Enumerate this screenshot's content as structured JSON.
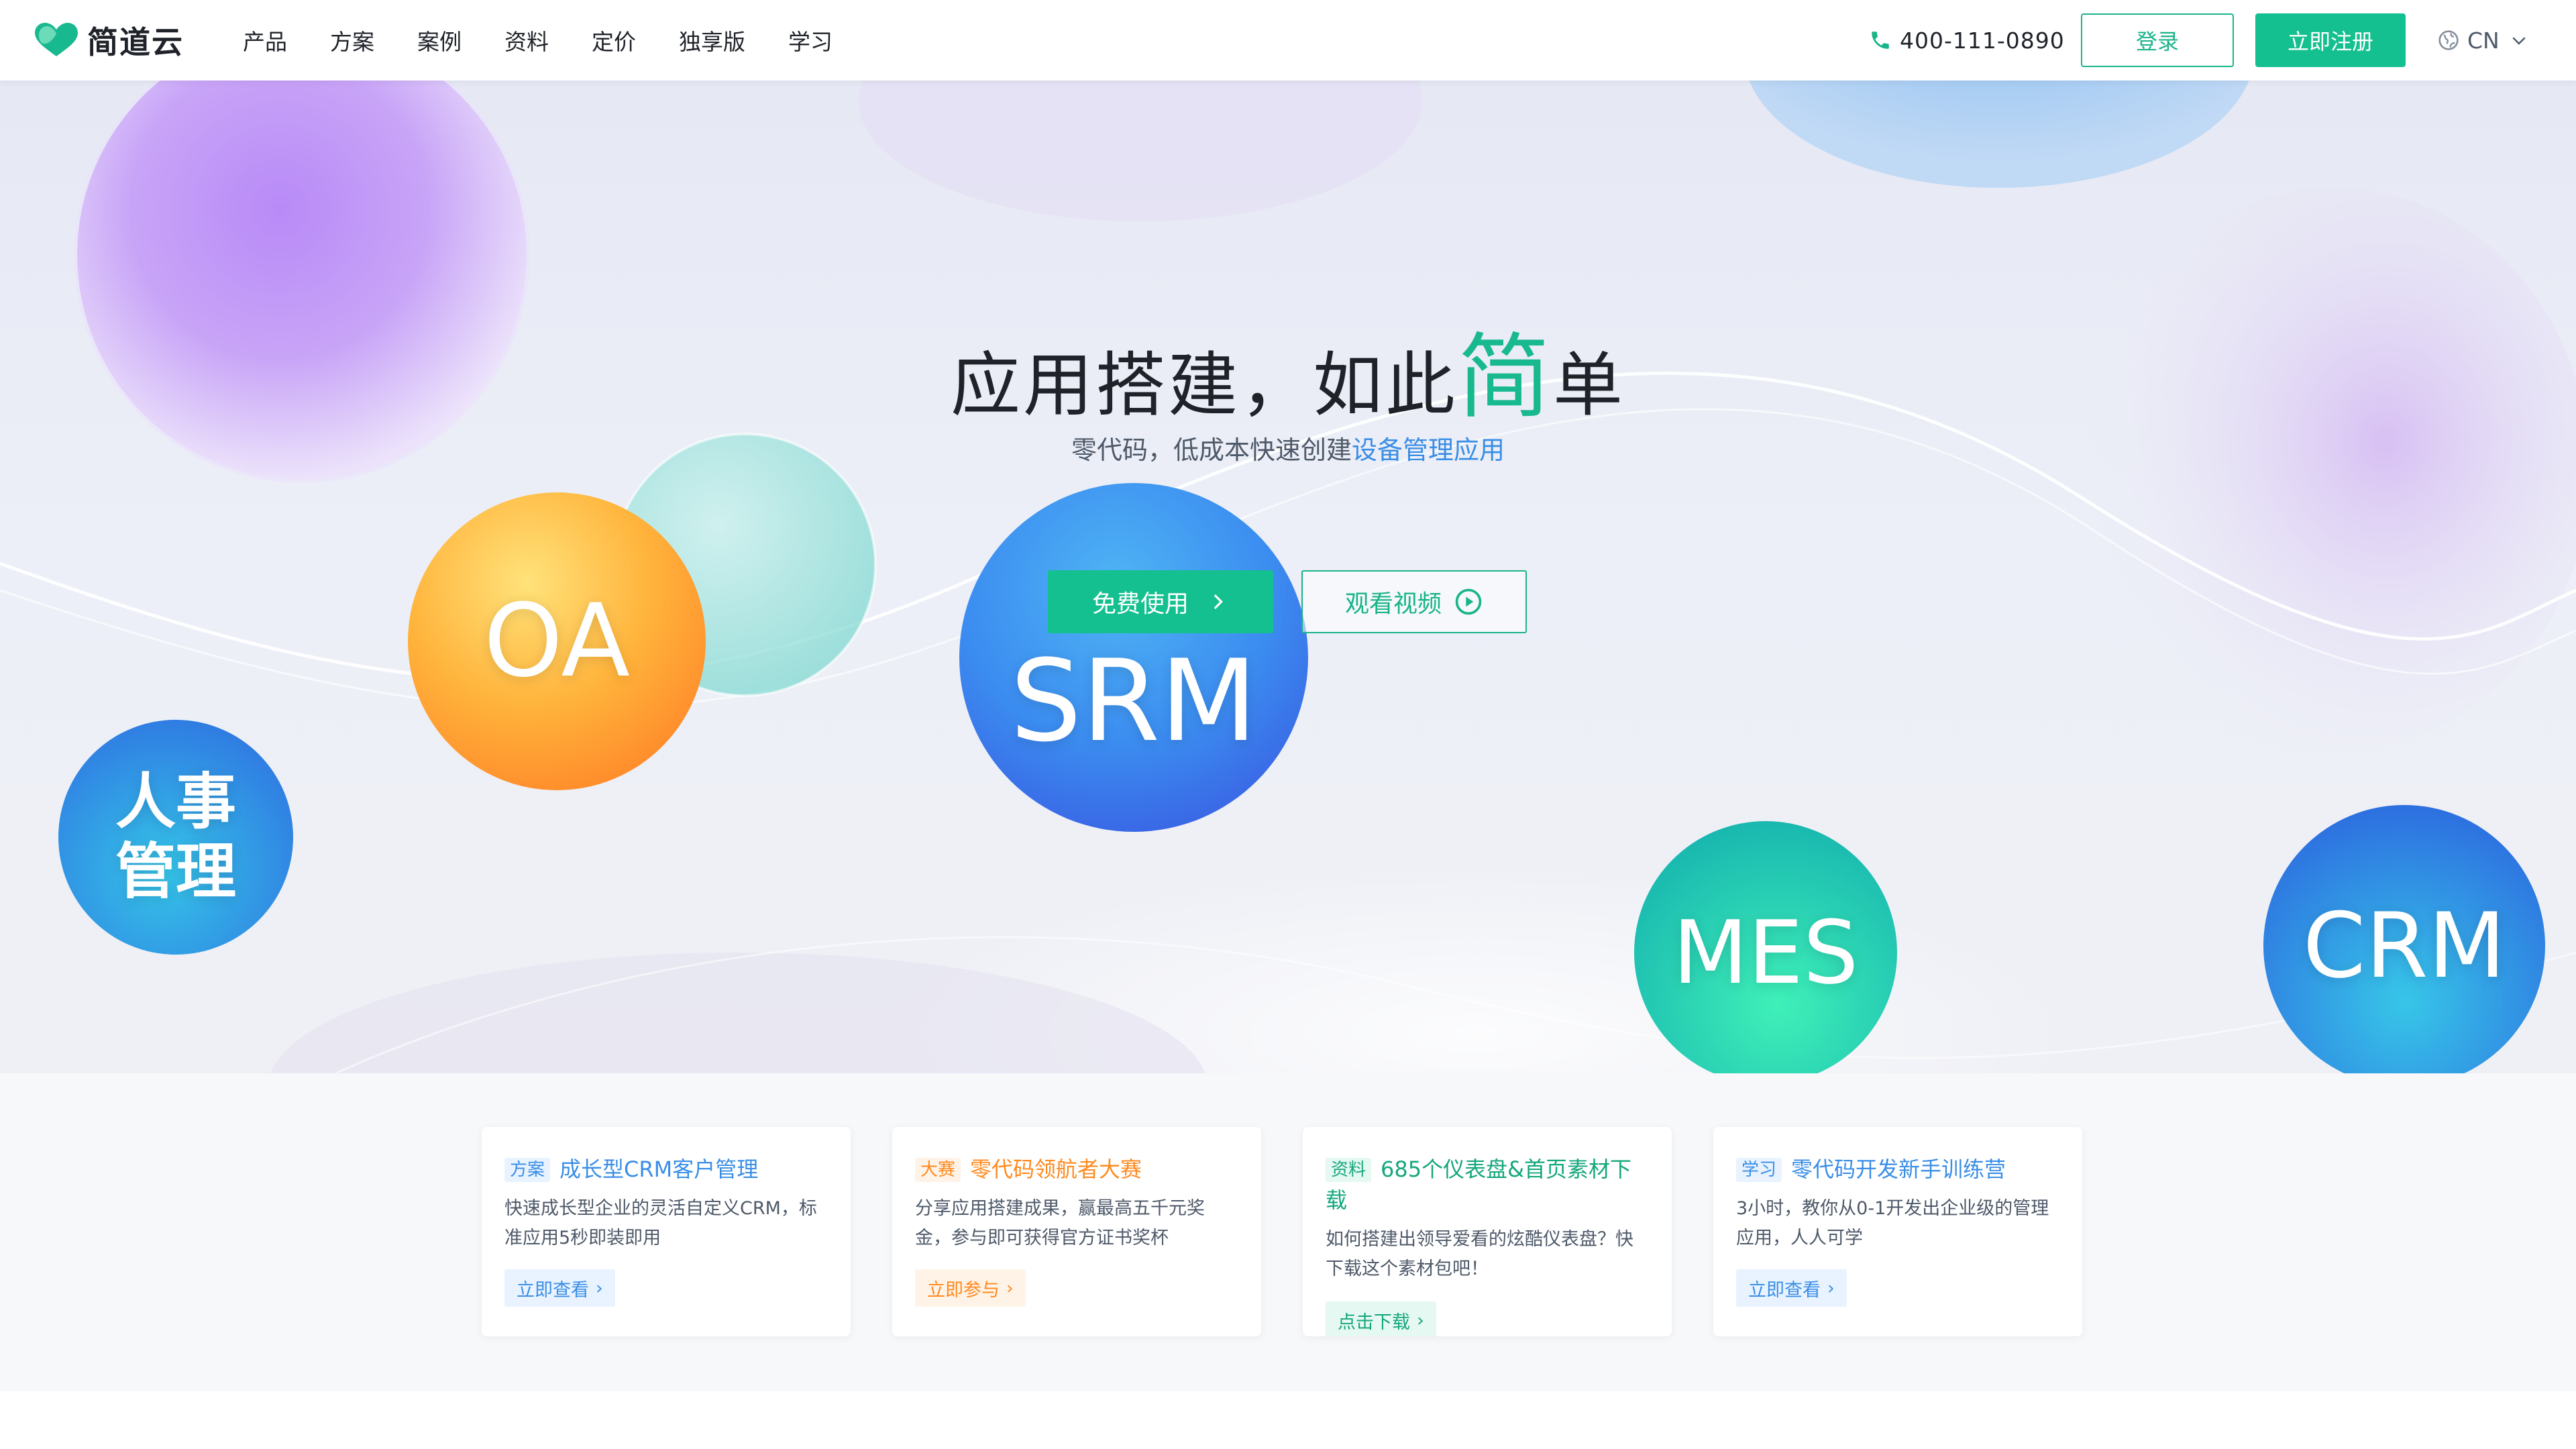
{
  "brand": {
    "name": "简道云"
  },
  "nav": {
    "items": [
      "产品",
      "方案",
      "案例",
      "资料",
      "定价",
      "独享版",
      "学习"
    ]
  },
  "header": {
    "phone": "400-111-0890",
    "login_label": "登录",
    "register_label": "立即注册",
    "lang_label": "CN"
  },
  "hero": {
    "title_prefix": "应用搭建，如此",
    "title_accent": "简",
    "title_suffix": "单",
    "subtitle_prefix": "零代码，低成本快速创建",
    "subtitle_highlight": "设备管理应用",
    "free_button": "免费使用",
    "video_button": "观看视频",
    "bubbles": {
      "hr": [
        "人事",
        "管理"
      ],
      "oa": "OA",
      "srm": "SRM",
      "mes": "MES",
      "crm": "CRM"
    }
  },
  "cards": [
    {
      "tag": "方案",
      "title": "成长型CRM客户管理",
      "desc": "快速成长型企业的灵活自定义CRM，标准应用5秒即装即用",
      "button": "立即查看"
    },
    {
      "tag": "大赛",
      "title": "零代码领航者大赛",
      "desc": "分享应用搭建成果，赢最高五千元奖金，参与即可获得官方证书奖杯",
      "button": "立即参与"
    },
    {
      "tag": "资料",
      "title": "685个仪表盘&首页素材下载",
      "desc": "如何搭建出领导爱看的炫酷仪表盘？快下载这个素材包吧！",
      "button": "点击下载"
    },
    {
      "tag": "学习",
      "title": "零代码开发新手训练营",
      "desc": "3小时，教你从0-1开发出企业级的管理应用，人人可学",
      "button": "立即查看"
    }
  ],
  "colors": {
    "brand_green": "#14c08f",
    "link_blue": "#3a8ee6",
    "accent_orange": "#ff8a1f"
  }
}
